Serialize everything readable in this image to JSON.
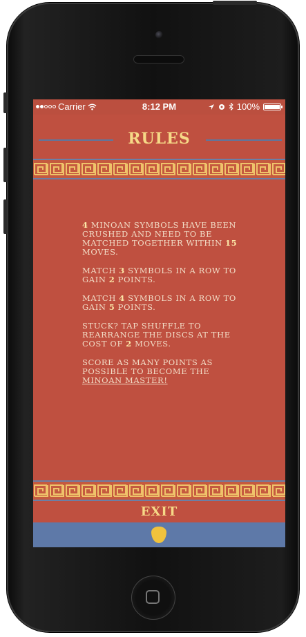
{
  "status_bar": {
    "carrier": "Carrier",
    "time": "8:12 PM",
    "battery": "100%"
  },
  "header": {
    "title": "RULES"
  },
  "rules": {
    "p1": {
      "a": "4",
      "b": " minoan symbols have been crushed and need to be matched together within ",
      "c": "15",
      "d": " moves."
    },
    "p2": {
      "a": "Match ",
      "b": "3",
      "c": " symbols in a row to gain ",
      "d": "2",
      "e": " points."
    },
    "p3": {
      "a": "Match ",
      "b": "4",
      "c": " symbols in a row to gain ",
      "d": "5",
      "e": " points."
    },
    "p4": {
      "a": "Stuck? Tap shuffle to rearrange the discs at the cost of ",
      "b": "2",
      "c": " moves."
    },
    "p5": {
      "a": "Score as many points as possible to become the ",
      "b": "Minoan Master!"
    }
  },
  "footer": {
    "exit_label": "EXIT"
  },
  "colors": {
    "screen_bg": "#bf5040",
    "title_gold": "#f6d987",
    "band_blue": "#5e79a8",
    "shield_gold": "#f0c23d"
  }
}
